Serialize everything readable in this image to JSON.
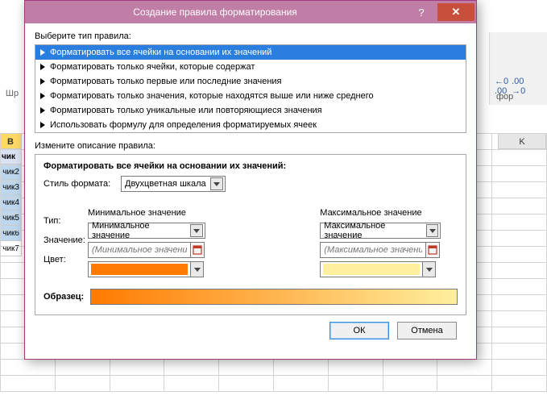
{
  "bg": {
    "col_b": "B",
    "col_k": "K",
    "row_header": "чик",
    "rows": [
      "чик2",
      "чик3",
      "чик4",
      "чик5",
      "чик6",
      "чик7"
    ],
    "left_group_label": "Шр",
    "ribbon_label": "фор",
    "dec_inc": "←,0\n,00",
    "dec_dec": ",00\n→,0"
  },
  "dialog": {
    "title": "Создание правила форматирования",
    "help": "?",
    "close": "✕",
    "select_rule_label": "Выберите тип правила:",
    "rules": [
      "Форматировать все ячейки на основании их значений",
      "Форматировать только ячейки, которые содержат",
      "Форматировать только первые или последние значения",
      "Форматировать только значения, которые находятся выше или ниже среднего",
      "Форматировать только уникальные или повторяющиеся значения",
      "Использовать формулу для определения форматируемых ячеек"
    ],
    "edit_label": "Измените описание правила:",
    "desc_heading": "Форматировать все ячейки на основании их значений:",
    "style_label": "Стиль формата:",
    "style_value": "Двухцветная шкала",
    "min_header": "Минимальное значение",
    "max_header": "Максимальное значение",
    "type_label": "Тип:",
    "type_min": "Минимальное значение",
    "type_max": "Максимальное значение",
    "value_label": "Значение:",
    "value_min_ph": "(Минимальное значение",
    "value_max_ph": "(Максимальное значение",
    "color_label": "Цвет:",
    "color_min": "#ff7a00",
    "color_max": "#ffef9e",
    "sample_label": "Образец:",
    "ok": "ОК",
    "cancel": "Отмена"
  }
}
